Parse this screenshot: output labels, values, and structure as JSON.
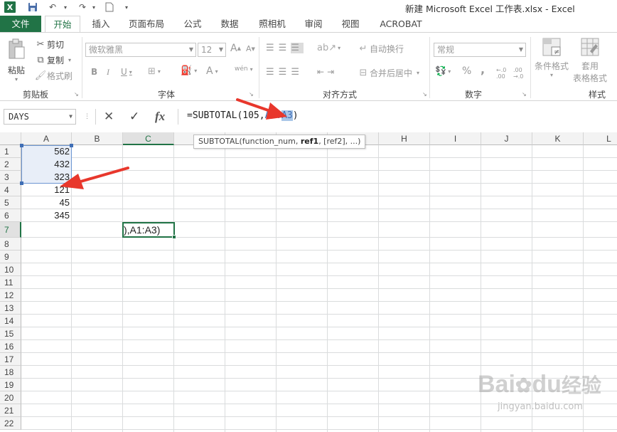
{
  "window": {
    "title": "新建 Microsoft Excel 工作表.xlsx - Excel",
    "app_icon": "excel-icon"
  },
  "tabs": [
    {
      "id": "file",
      "label": "文件"
    },
    {
      "id": "home",
      "label": "开始"
    },
    {
      "id": "insert",
      "label": "插入"
    },
    {
      "id": "layout",
      "label": "页面布局"
    },
    {
      "id": "formulas",
      "label": "公式"
    },
    {
      "id": "data",
      "label": "数据"
    },
    {
      "id": "camera",
      "label": "照相机"
    },
    {
      "id": "review",
      "label": "审阅"
    },
    {
      "id": "view",
      "label": "视图"
    },
    {
      "id": "acrobat",
      "label": "ACROBAT"
    }
  ],
  "ribbon": {
    "clipboard": {
      "label": "剪贴板",
      "paste": "粘贴",
      "cut": "剪切",
      "copy": "复制",
      "format_painter": "格式刷"
    },
    "font": {
      "label": "字体",
      "font_name": "微软雅黑",
      "font_size": "12",
      "grow": "A",
      "shrink": "A",
      "bold": "B",
      "italic": "I",
      "underline": "U",
      "font_color": "A",
      "phonetic": "wén"
    },
    "alignment": {
      "label": "对齐方式",
      "wrap_text": "自动换行",
      "merge_center": "合并后居中"
    },
    "number": {
      "label": "数字",
      "format": "常规",
      "percent": "%",
      "comma": ",",
      "inc_decimal": "←.0 .00",
      "dec_decimal": ".00 →.0"
    },
    "styles": {
      "label": "样式",
      "conditional_format": "条件格式",
      "table_format_1": "套用",
      "table_format_2": "表格格式"
    }
  },
  "formula_bar": {
    "name_box": "DAYS",
    "cancel": "✕",
    "enter": "✓",
    "fx": "fx",
    "prefix": "=SUBTOTAL(105,",
    "ref1": "A1",
    "colon": ":",
    "ref2": "A3",
    "suffix": ")"
  },
  "tooltip": {
    "fn": "SUBTOTAL(function_num, ",
    "bold_arg": "ref1",
    "rest": ", [ref2], ...)"
  },
  "columns": [
    "A",
    "B",
    "C",
    "D",
    "E",
    "F",
    "G",
    "H",
    "I",
    "J",
    "K",
    "L"
  ],
  "rows": [
    "1",
    "2",
    "3",
    "4",
    "5",
    "6",
    "7",
    "8",
    "9",
    "10",
    "11",
    "12",
    "13",
    "14",
    "15",
    "16",
    "17",
    "18",
    "19",
    "20",
    "21",
    "22"
  ],
  "cells": {
    "A1": "562",
    "A2": "432",
    "A3": "323",
    "A4": "121",
    "A5": "45",
    "A6": "345",
    "C7": "),A1:A3)"
  },
  "watermark": {
    "brand": "Bai",
    "brand2": "du",
    "suffix": "经验",
    "url": "jingyan.baidu.com"
  },
  "colors": {
    "excel_green": "#217346",
    "ref_blue": "#3f6eb5",
    "arrow_red": "#e8372c"
  }
}
